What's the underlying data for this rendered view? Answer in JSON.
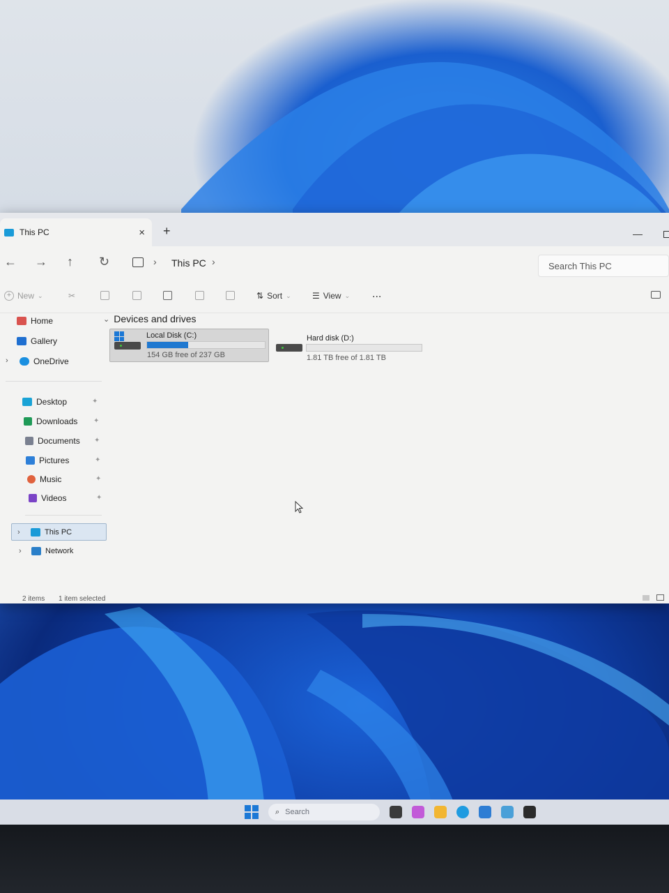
{
  "window": {
    "tab_title": "This PC",
    "new_tab_label": "+",
    "close_tab_label": "×",
    "minimize_label": "—"
  },
  "address": {
    "crumbs": [
      "This PC"
    ],
    "separator": "›",
    "search_placeholder": "Search This PC"
  },
  "toolbar": {
    "new_label": "New",
    "sort_label": "Sort",
    "view_label": "View",
    "more_label": "..."
  },
  "sidebar": {
    "quick": [
      {
        "label": "Home",
        "icon": "home-icon",
        "color": "#d9534f"
      },
      {
        "label": "Gallery",
        "icon": "gallery-icon",
        "color": "#1f6fd0"
      },
      {
        "label": "OneDrive",
        "icon": "cloud-icon",
        "color": "#1a8fe0"
      }
    ],
    "pinned": [
      {
        "label": "Desktop",
        "icon": "desktop-icon",
        "color": "#1aa3d6"
      },
      {
        "label": "Downloads",
        "icon": "download-icon",
        "color": "#1f9a57"
      },
      {
        "label": "Documents",
        "icon": "documents-icon",
        "color": "#7a8090"
      },
      {
        "label": "Pictures",
        "icon": "pictures-icon",
        "color": "#2d7fd8"
      },
      {
        "label": "Music",
        "icon": "music-icon",
        "color": "#e0623e"
      },
      {
        "label": "Videos",
        "icon": "videos-icon",
        "color": "#7a43c6"
      }
    ],
    "locations": [
      {
        "label": "This PC",
        "icon": "computer-icon",
        "color": "#1a9bd8"
      },
      {
        "label": "Network",
        "icon": "network-icon",
        "color": "#2a7fc9"
      }
    ]
  },
  "content": {
    "group_title": "Devices and drives",
    "drives": [
      {
        "name": "Local Disk (C:)",
        "free_text": "154 GB free of 237 GB",
        "used_fraction": 0.35
      },
      {
        "name": "Hard disk (D:)",
        "free_text": "1.81 TB free of 1.81 TB",
        "used_fraction": 0.0
      }
    ]
  },
  "status": {
    "item_count": "2 items",
    "selection": "1 item selected"
  },
  "taskbar": {
    "search_placeholder": "Search",
    "app_colors": [
      "#3a3a3a",
      "#c25ad8",
      "#f2b632",
      "#1f9be0",
      "#2e7dd4",
      "#4aa0d8",
      "#2b2b2b"
    ]
  }
}
